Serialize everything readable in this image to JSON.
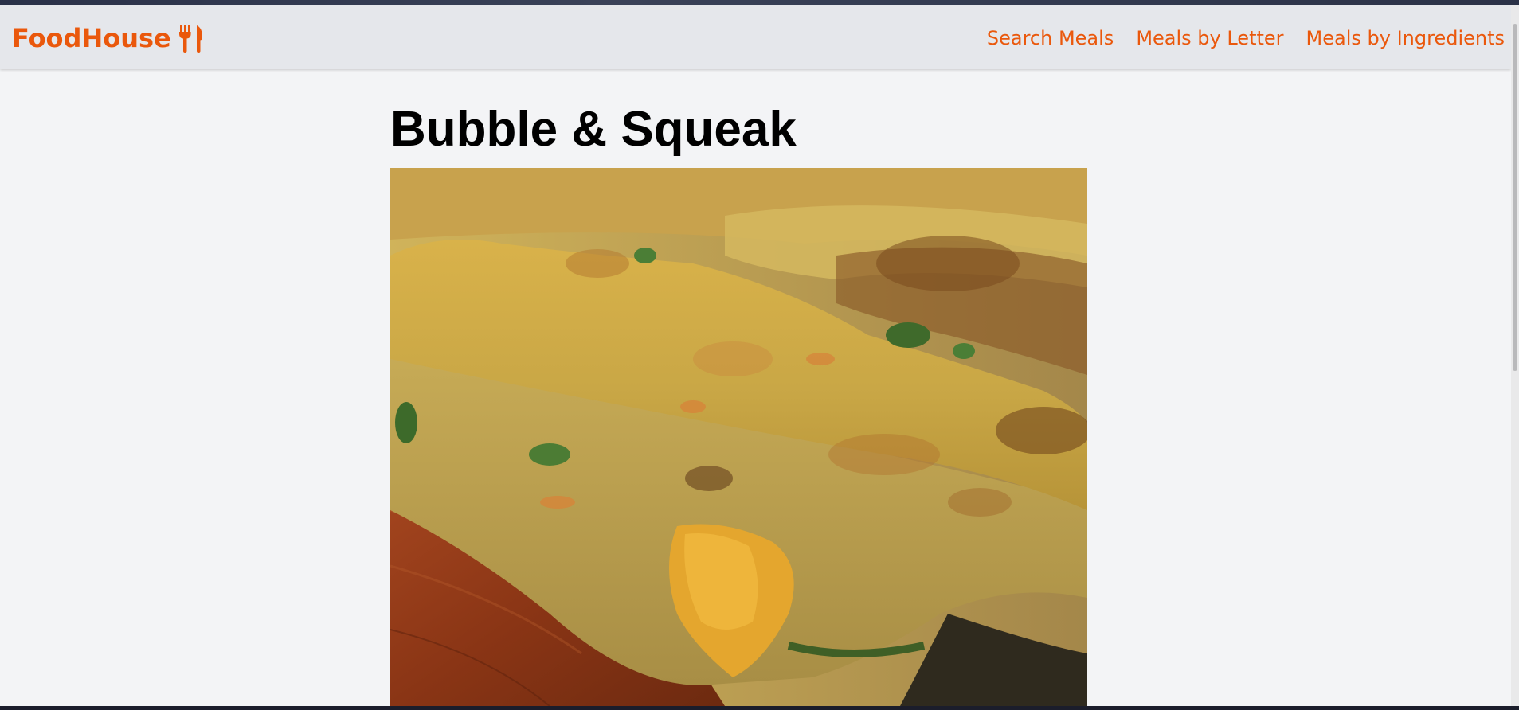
{
  "site": {
    "brand_name": "FoodHouse",
    "brand_icon": "fork-knife-icon",
    "accent_color": "#ea580c"
  },
  "nav": {
    "links": [
      {
        "label": "Search Meals"
      },
      {
        "label": "Meals by Letter"
      },
      {
        "label": "Meals by Ingredients"
      }
    ]
  },
  "meal": {
    "title": "Bubble & Squeak",
    "image_alt": "Bubble & Squeak"
  }
}
